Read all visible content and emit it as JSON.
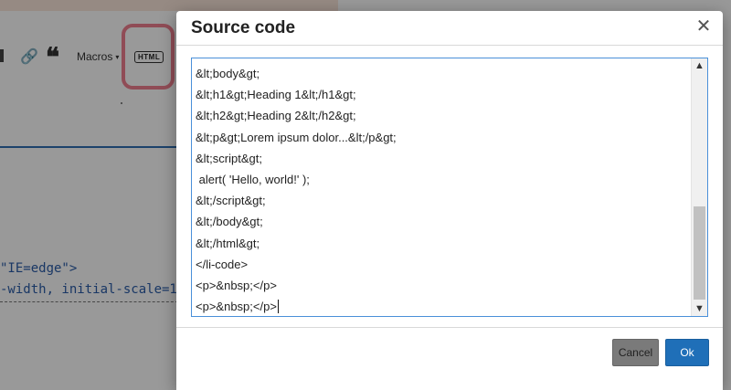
{
  "editor": {
    "toolbar": {
      "macros_label": "Macros",
      "macros_caret": "▾",
      "html_label": "HTML",
      "link_glyph": "🔗",
      "quote_glyph": "❝"
    },
    "code_line1": "\"IE=edge\">",
    "code_line2": "-width, initial-scale=1\""
  },
  "dialog": {
    "title": "Source code",
    "close_glyph": "✕",
    "lines": [
      "&lt;body&gt;",
      "&lt;h1&gt;Heading 1&lt;/h1&gt;",
      "&lt;h2&gt;Heading 2&lt;/h2&gt;",
      "&lt;p&gt;Lorem ipsum dolor...&lt;/p&gt;",
      "&lt;script&gt;",
      " alert( 'Hello, world!' );",
      "&lt;/script&gt;",
      "&lt;/body&gt;",
      "&lt;/html&gt;",
      "</li-code>",
      "<p>&nbsp;</p>",
      "<p>&nbsp;</p>"
    ],
    "scroll_up_glyph": "▲",
    "scroll_down_glyph": "▼",
    "cancel_label": "Cancel",
    "ok_label": "Ok"
  }
}
